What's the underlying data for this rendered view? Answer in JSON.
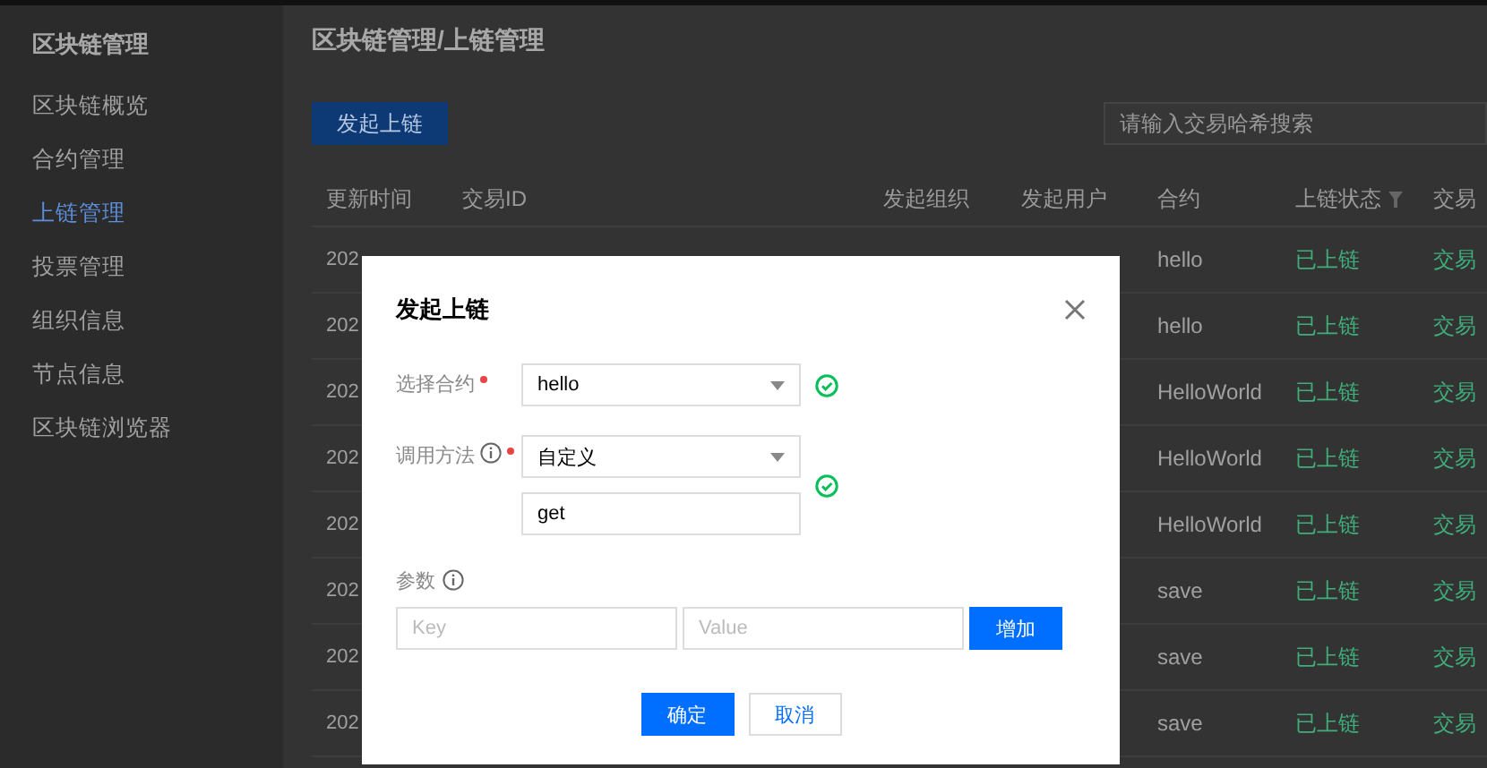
{
  "sidebar": {
    "title": "区块链管理",
    "items": [
      {
        "label": "区块链概览",
        "selected": false
      },
      {
        "label": "合约管理",
        "selected": false
      },
      {
        "label": "上链管理",
        "selected": true
      },
      {
        "label": "投票管理",
        "selected": false
      },
      {
        "label": "组织信息",
        "selected": false
      },
      {
        "label": "节点信息",
        "selected": false
      },
      {
        "label": "区块链浏览器",
        "selected": false
      }
    ]
  },
  "header": {
    "breadcrumb": "区块链管理/上链管理"
  },
  "toolbar": {
    "button": "发起上链",
    "search": {
      "placeholder": "请输入交易哈希搜索"
    }
  },
  "table": {
    "columns": [
      {
        "label": "更新时间",
        "filterable": false
      },
      {
        "label": "交易ID",
        "filterable": false
      },
      {
        "label": "发起组织",
        "filterable": false
      },
      {
        "label": "发起用户",
        "filterable": false
      },
      {
        "label": "合约",
        "filterable": false
      },
      {
        "label": "上链状态",
        "filterable": true
      },
      {
        "label": "交易",
        "filterable": false
      }
    ],
    "rows": [
      {
        "time": "202",
        "contract": "hello",
        "chain_status": "已上链",
        "tx_status": "交易"
      },
      {
        "time": "202",
        "contract": "hello",
        "chain_status": "已上链",
        "tx_status": "交易"
      },
      {
        "time": "202",
        "contract": "HelloWorld",
        "chain_status": "已上链",
        "tx_status": "交易"
      },
      {
        "time": "202",
        "contract": "HelloWorld",
        "chain_status": "已上链",
        "tx_status": "交易"
      },
      {
        "time": "202",
        "contract": "HelloWorld",
        "chain_status": "已上链",
        "tx_status": "交易"
      },
      {
        "time": "202",
        "contract": "save",
        "chain_status": "已上链",
        "tx_status": "交易"
      },
      {
        "time": "202",
        "contract": "save",
        "chain_status": "已上链",
        "tx_status": "交易"
      },
      {
        "time": "202",
        "contract": "save",
        "chain_status": "已上链",
        "tx_status": "交易"
      }
    ]
  },
  "modal": {
    "title": "发起上链",
    "fields": [
      {
        "label": "选择合约",
        "required": true,
        "info": false,
        "valid": true,
        "controls": [
          {
            "kind": "select",
            "value": "hello"
          }
        ]
      },
      {
        "label": "调用方法",
        "required": true,
        "info": true,
        "valid": true,
        "controls": [
          {
            "kind": "select",
            "value": "自定义"
          },
          {
            "kind": "input",
            "value": "get"
          }
        ]
      }
    ],
    "params": {
      "label": "参数",
      "info": true,
      "key_placeholder": "Key",
      "value_placeholder": "Value",
      "add_button": "增加"
    },
    "buttons": [
      {
        "label": "确定",
        "primary": true
      },
      {
        "label": "取消",
        "primary": false
      }
    ]
  }
}
